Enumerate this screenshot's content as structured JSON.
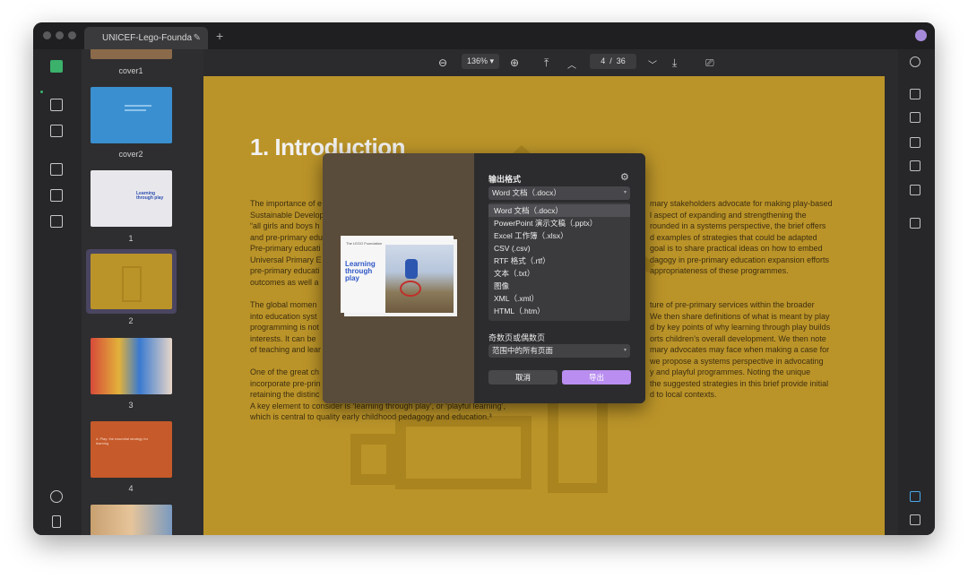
{
  "window": {
    "tab_title": "UNICEF-Lego-Foundation",
    "tab_edit_icon": "pencil-icon",
    "new_tab": "+"
  },
  "thumbnails": {
    "items": [
      {
        "label": "cover1",
        "color": "#8a6a4a"
      },
      {
        "label": "cover2",
        "color": "#3a8fd0"
      },
      {
        "label": "1",
        "color": "#e8e8ec"
      },
      {
        "label": "2",
        "color": "#bb9429"
      },
      {
        "label": "3",
        "color": "#c65a4a"
      },
      {
        "label": "4",
        "color": "#c65a2a"
      },
      {
        "label": "",
        "color": "#b07050"
      }
    ],
    "page1": {
      "title": "Learning through play"
    },
    "page4": {
      "title": "4. Play: the essential strategy for learning"
    }
  },
  "toolbar": {
    "zoom": "136%",
    "page_current": "4",
    "page_sep": "/",
    "page_total": "36"
  },
  "document": {
    "heading": "1. Introduction",
    "para1": [
      "The importance of e",
      "Sustainable Develop",
      "“all girls and boys h",
      "and pre-primary edu",
      "Pre-primary educati",
      "Universal Primary E",
      "pre-primary educati",
      "outcomes as well a"
    ],
    "para1_right": [
      "mary stakeholders advocate for making play-based",
      "l aspect of expanding and strengthening the",
      "rounded in a systems perspective, the brief offers",
      "d examples of strategies that could be adapted",
      "goal is to share practical ideas on how to embed",
      "dagogy in pre-primary education expansion efforts",
      "appropriateness of these programmes."
    ],
    "para2": [
      "The global momen",
      "into education syst",
      "programming is not",
      "interests. It can be",
      "of teaching and lear"
    ],
    "para2_right": [
      "ture of pre-primary services within the broader",
      "We then share definitions of what is meant by play",
      "d by key points of why learning through play builds",
      "orts children’s overall development. We then note",
      "mary advocates may face when making a case for",
      "we propose a systems perspective in advocating",
      "y and playful programmes. Noting the unique",
      "the suggested strategies in this brief provide initial",
      "d to local contexts."
    ],
    "para3": [
      "One of the great ch",
      "incorporate pre-prin",
      "retaining the distinc",
      "A key element to consider is ‘learning through play’, or ‘playful learning’,",
      "which is central to quality early childhood pedagogy and education.³"
    ]
  },
  "dialog": {
    "output_format_label": "输出格式",
    "settings_icon": "gear-icon",
    "selected_format": "Word 文档（.docx）",
    "formats": [
      "Word 文档（.docx）",
      "PowerPoint 演示文稿（.pptx）",
      "Excel 工作簿（.xlsx）",
      "CSV (.csv)",
      "RTF 格式（.rtf）",
      "文本（.txt）",
      "图像",
      "XML（.xml）",
      "HTML（.htm）"
    ],
    "odd_even_label": "奇数页或偶数页",
    "range_value": "范围中的所有页面",
    "cancel": "取消",
    "export": "导出",
    "preview": {
      "brand": "The LEGO Foundation",
      "title": "Learning through play"
    }
  },
  "colors": {
    "accent": "#3bb16c",
    "export_button": "#b98ef0",
    "doc_bg": "#bb9429"
  }
}
